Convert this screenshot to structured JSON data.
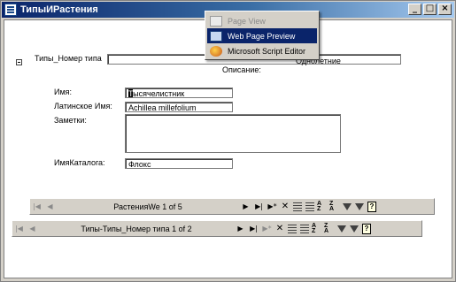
{
  "window": {
    "title": "ТипыИРастения",
    "controls": {
      "minimize": "_",
      "restore": "□",
      "close": "×"
    }
  },
  "form": {
    "type_id_label": "Типы_Номер типа",
    "description_label": "Описание:",
    "description_value": "Однолетние",
    "name_label": "Имя:",
    "name_value_first": "Т",
    "name_value_rest": "ысячелистник",
    "latin_label": "Латинское Имя:",
    "latin_value": "Achillea millefolium",
    "notes_label": "Заметки:",
    "notes_value": "",
    "catalog_label": "ИмяКаталога:",
    "catalog_value": "Флокс"
  },
  "nav_plants": {
    "label": "РастенияWe 1 of 5"
  },
  "nav_types": {
    "label": "Типы-Типы_Номер типа 1 of 2"
  },
  "icons": {
    "first": "first-record-icon",
    "prev": "prev-record-icon",
    "next": "next-record-icon",
    "last": "last-record-icon"
  },
  "context_menu": {
    "items": [
      {
        "label": "Page View",
        "state": "disabled",
        "icon": "page-view-icon"
      },
      {
        "label": "Web Page Preview",
        "state": "selected",
        "icon": "web-page-icon"
      },
      {
        "label": "Microsoft Script Editor",
        "state": "normal",
        "icon": "script-editor-icon"
      }
    ]
  },
  "colors": {
    "titlebar_start": "#0a246a",
    "titlebar_end": "#a6caf0",
    "menu_highlight": "#0a246a",
    "face": "#d4d0c8"
  }
}
